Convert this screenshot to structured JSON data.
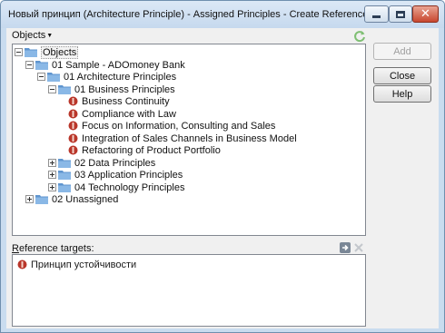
{
  "window": {
    "title": "Новый принцип (Architecture Principle) - Assigned Principles - Create Reference"
  },
  "menu": {
    "objects_label": "Objects"
  },
  "tree": {
    "root": "Objects",
    "sample": "01 Sample - ADOmoney Bank",
    "architecture_principles": "01 Architecture Principles",
    "business_principles": "01 Business Principles",
    "principles": [
      "Business Continuity",
      "Compliance with Law",
      "Focus on Information, Consulting and Sales",
      "Integration of Sales Channels in Business Model",
      "Refactoring of Product Portfolio"
    ],
    "data_principles": "02 Data Principles",
    "application_principles": "03 Application Principles",
    "technology_principles": "04 Technology Principles",
    "unassigned": "02 Unassigned"
  },
  "buttons": {
    "add": "Add",
    "close": "Close",
    "help": "Help"
  },
  "reference": {
    "label_first": "R",
    "label_rest": "eference targets:",
    "items": [
      "Принцип устойчивости"
    ]
  },
  "icons": {
    "folder": "folder-icon",
    "principle": "principle-icon",
    "refresh": "refresh-icon",
    "move": "arrow-right-icon",
    "remove": "delete-x-icon"
  },
  "colors": {
    "titlebar": "#c6d9ee",
    "close_button": "#c8472f",
    "folder": "#5f95cf",
    "principle": "#b9362a"
  }
}
